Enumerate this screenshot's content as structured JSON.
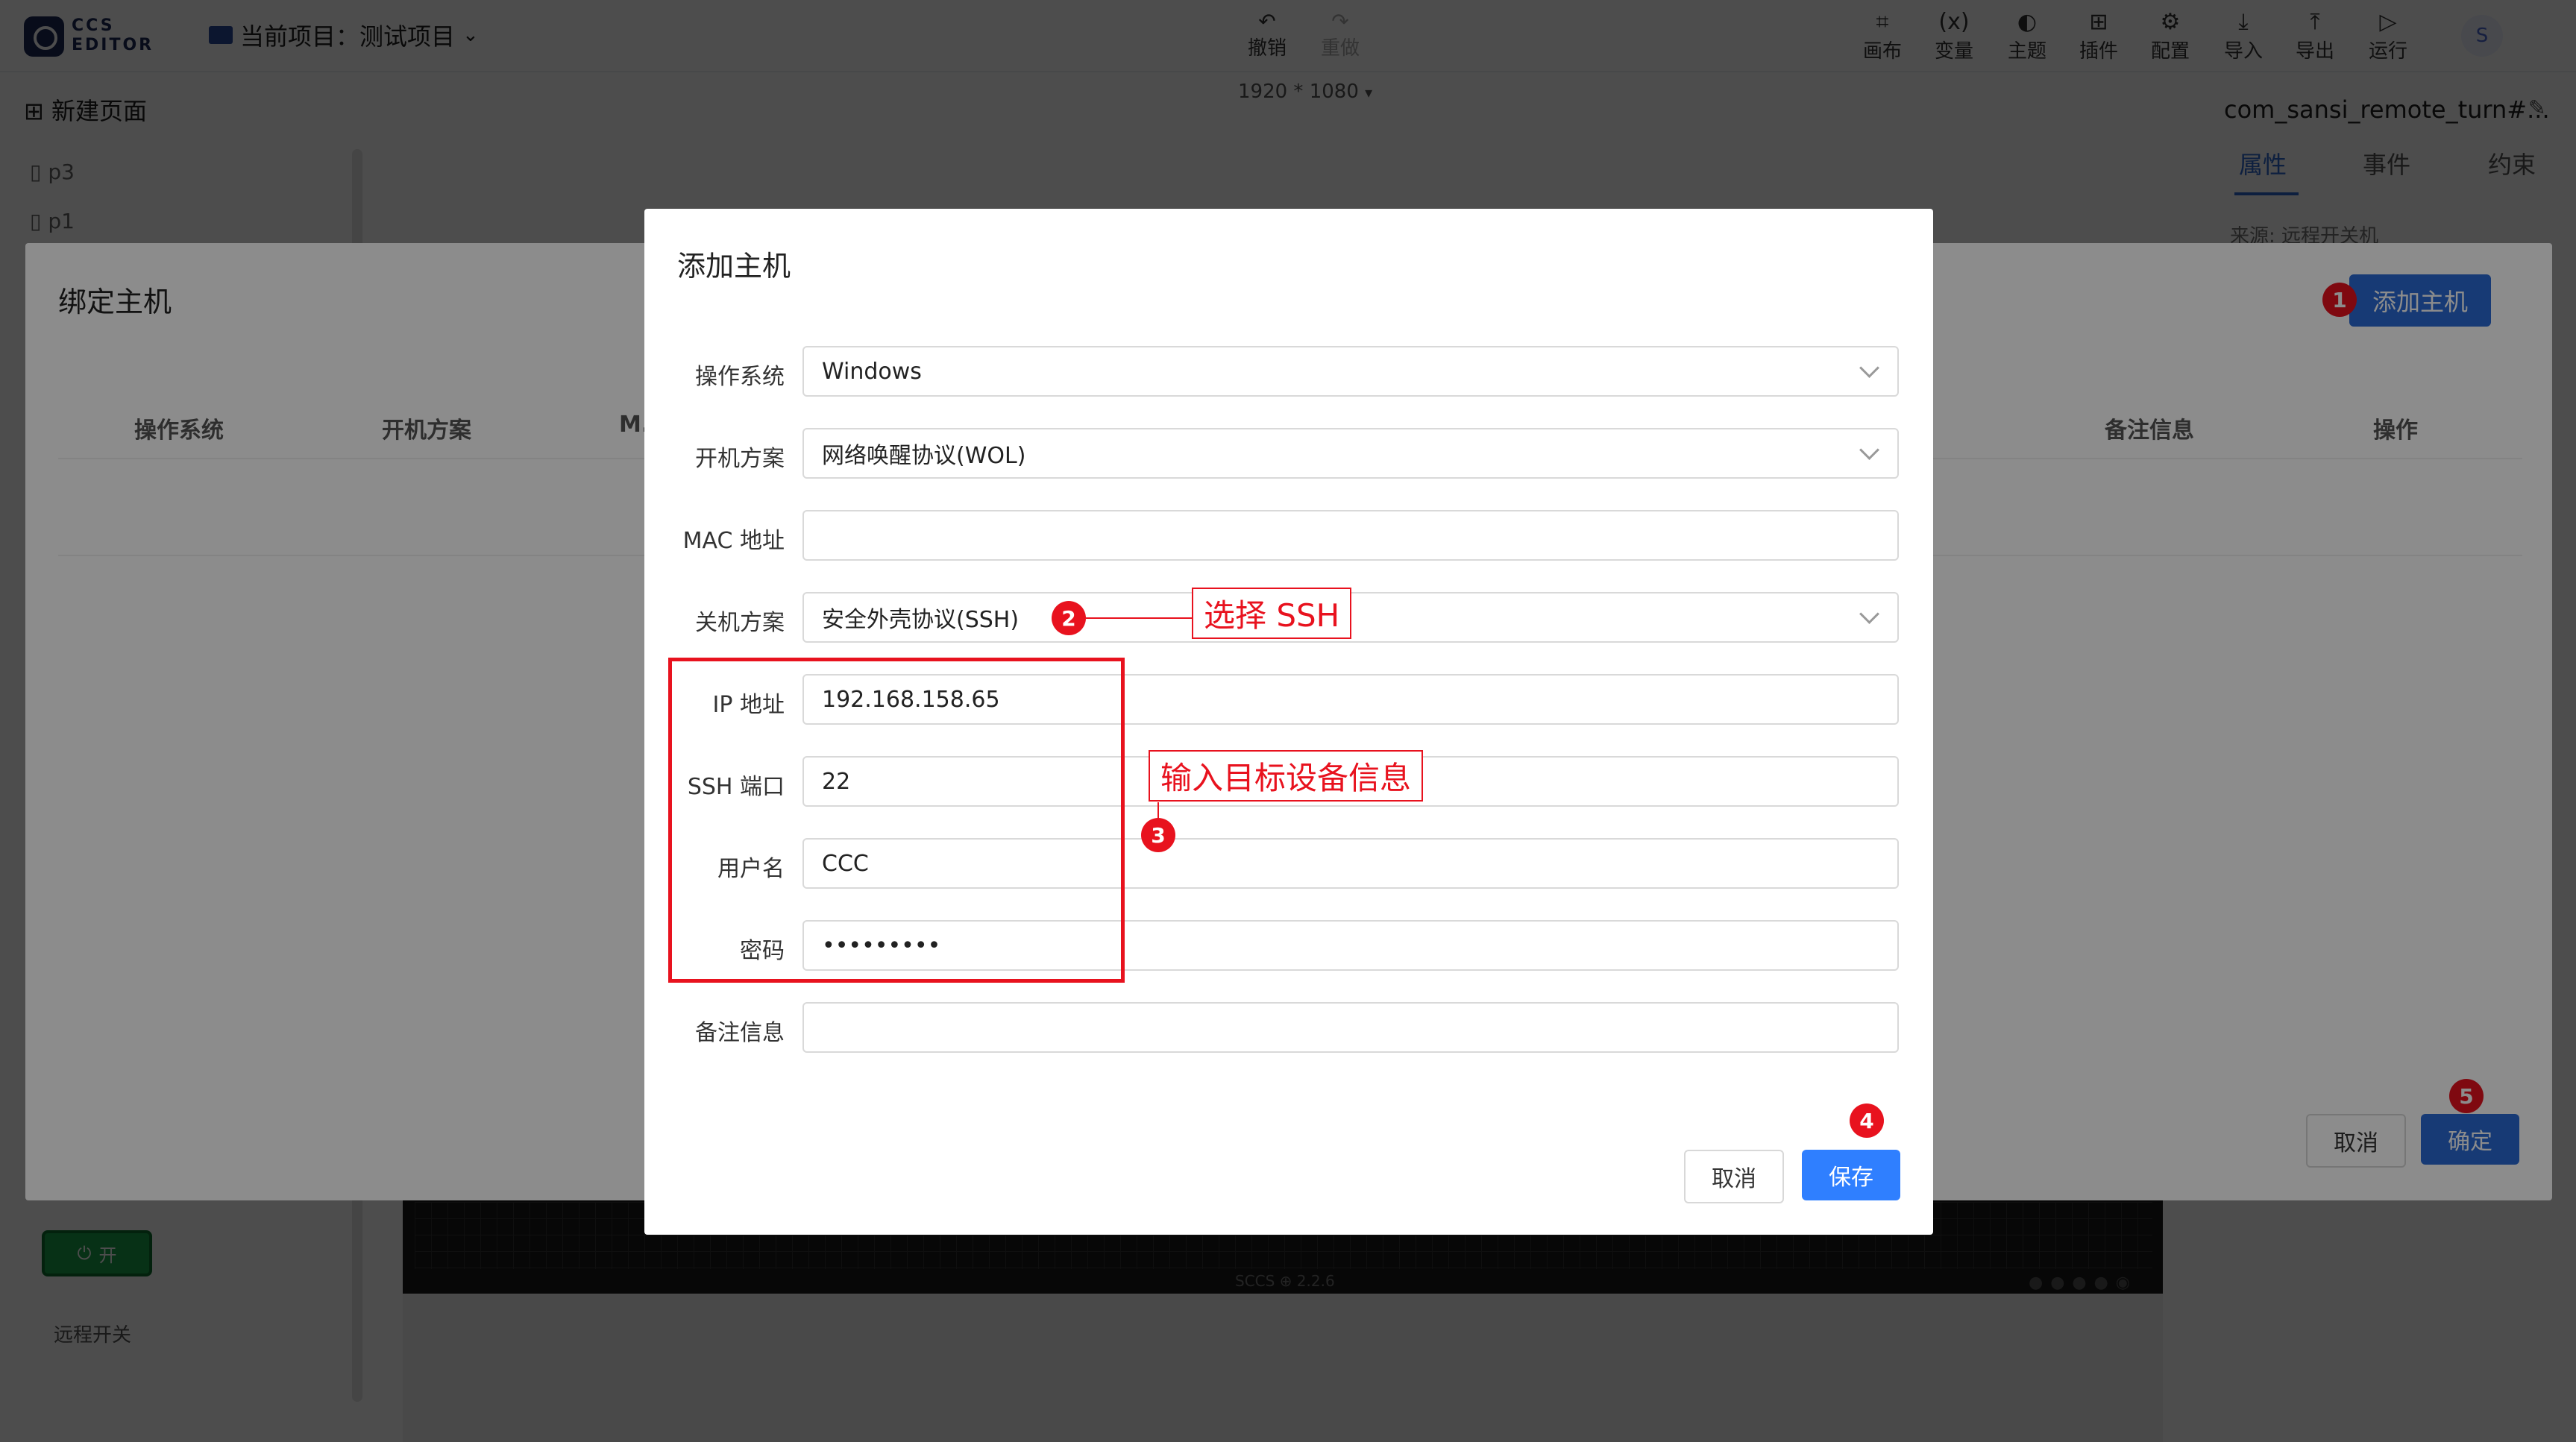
{
  "topbar": {
    "logo_text": "CCS\nEDITOR",
    "project_label": "当前项目：测试项目",
    "undo": "撤销",
    "redo": "重做",
    "tools": [
      {
        "label": "画布",
        "icon": "canvas-icon",
        "glyph": "⌗"
      },
      {
        "label": "变量",
        "icon": "variable-icon",
        "glyph": "(x)"
      },
      {
        "label": "主题",
        "icon": "theme-icon",
        "glyph": "◐"
      },
      {
        "label": "插件",
        "icon": "plugin-icon",
        "glyph": "⊞"
      },
      {
        "label": "配置",
        "icon": "config-icon",
        "glyph": "⚙"
      },
      {
        "label": "导入",
        "icon": "import-icon",
        "glyph": "⤓"
      },
      {
        "label": "导出",
        "icon": "export-icon",
        "glyph": "⤒"
      },
      {
        "label": "运行",
        "icon": "run-icon",
        "glyph": "▷"
      }
    ],
    "avatar": "S"
  },
  "resolution": "1920 * 1080",
  "left_panel": {
    "new_page": "新建页面",
    "pages": [
      "p3",
      "p1"
    ],
    "switch_label": "开",
    "switch_caption": "远程开关"
  },
  "canvas": {
    "version": "SCCS ⊕ 2.2.6"
  },
  "right_panel": {
    "component": "com_sansi_remote_turn#...",
    "tabs": [
      "属性",
      "事件",
      "约束"
    ],
    "source": "来源: 远程开关机"
  },
  "bind_dialog": {
    "title": "绑定主机",
    "add_host": "添加主机",
    "columns": [
      "操作系统",
      "开机方案",
      "M...",
      "备注信息",
      "操作"
    ],
    "cancel": "取消",
    "confirm": "确定"
  },
  "add_dialog": {
    "title": "添加主机",
    "fields": [
      {
        "label": "操作系统",
        "value": "Windows",
        "select": true
      },
      {
        "label": "开机方案",
        "value": "网络唤醒协议(WOL)",
        "select": true
      },
      {
        "label": "MAC 地址",
        "value": "",
        "select": false
      },
      {
        "label": "关机方案",
        "value": "安全外壳协议(SSH)",
        "select": true
      },
      {
        "label": "IP 地址",
        "value": "192.168.158.65",
        "select": false
      },
      {
        "label": "SSH 端口",
        "value": "22",
        "select": false
      },
      {
        "label": "用户名",
        "value": "CCC",
        "select": false
      },
      {
        "label": "密码",
        "value": "•••••••••",
        "select": false
      },
      {
        "label": "备注信息",
        "value": "",
        "select": false
      }
    ],
    "cancel": "取消",
    "save": "保存"
  },
  "annotations": {
    "badges": [
      "1",
      "2",
      "3",
      "4",
      "5"
    ],
    "note_ssh": "选择 SSH",
    "note_target": "输入目标设备信息",
    "color": "#e8121e"
  }
}
